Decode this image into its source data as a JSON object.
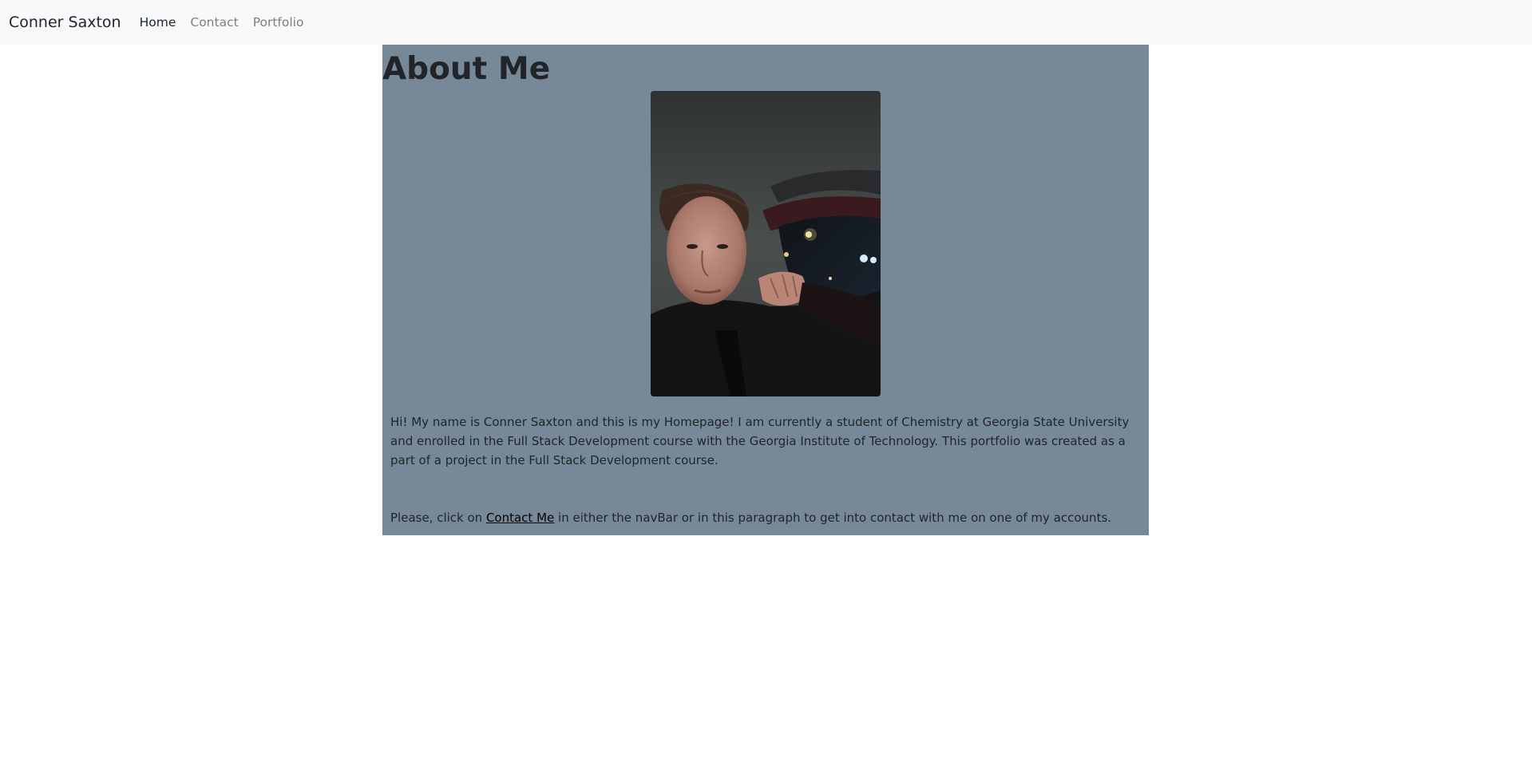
{
  "navbar": {
    "brand": "Conner Saxton",
    "links": [
      {
        "label": "Home",
        "active": true
      },
      {
        "label": "Contact",
        "active": false
      },
      {
        "label": "Portfolio",
        "active": false
      }
    ]
  },
  "about": {
    "title": "About Me",
    "background_color": "#778899",
    "intro": "Hi! My name is Conner Saxton and this is my Homepage! I am currently a student of Chemistry at Georgia State University and enrolled in the Full Stack Development course with the Georgia Institute of Technology. This portfolio was created as a part of a project in the Full Stack Development course.",
    "contact_prefix": "Please, click on ",
    "contact_link": "Contact Me",
    "contact_suffix": " in either the navBar or in this paragraph to get into contact with me on one of my accounts."
  }
}
